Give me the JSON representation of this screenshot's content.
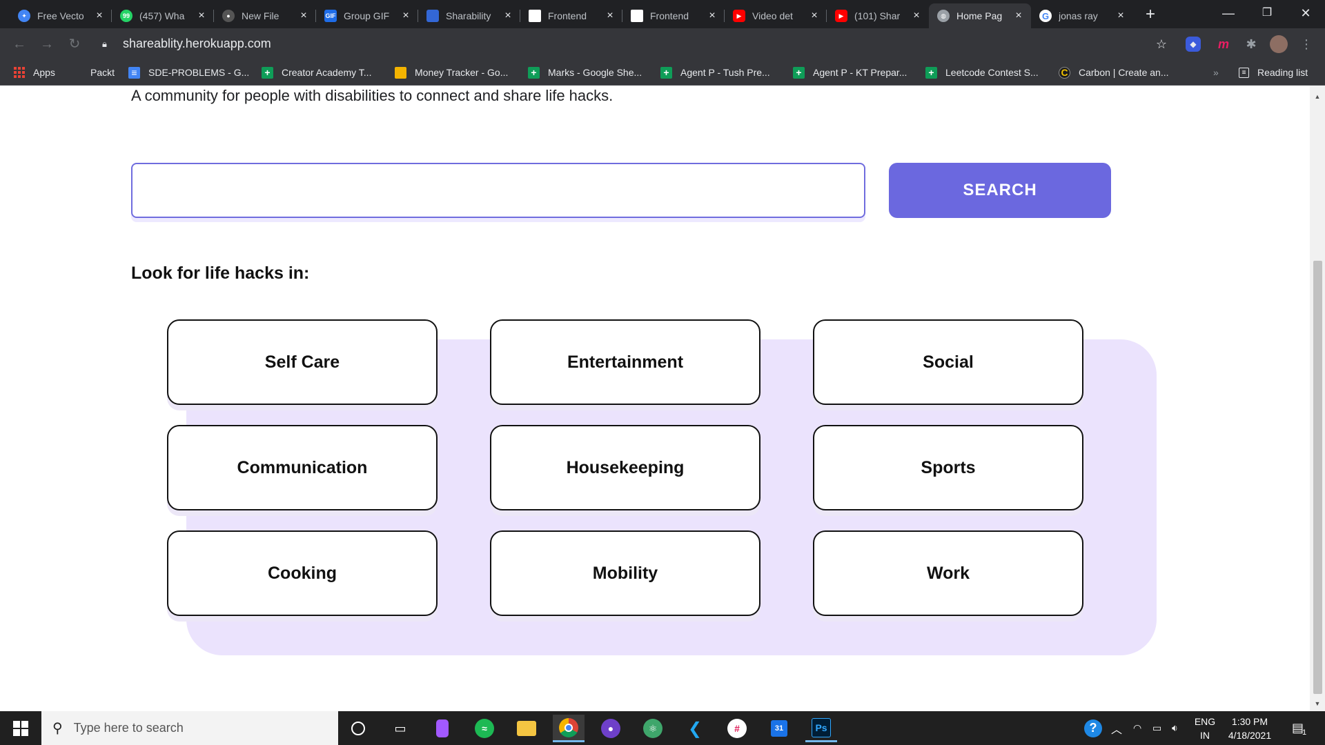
{
  "browser": {
    "tabs": [
      {
        "label": "Free Vecto",
        "icon": "shield-icon",
        "color": "#4285f4"
      },
      {
        "label": "(457) Wha",
        "icon": "whatsapp-icon",
        "color": "#25d366"
      },
      {
        "label": "New File",
        "icon": "github-icon",
        "color": "#555555"
      },
      {
        "label": "Group GIF",
        "icon": "gif-icon",
        "color": "#1e6ce8"
      },
      {
        "label": "Sharability",
        "icon": "doc-icon",
        "color": "#3367d6"
      },
      {
        "label": "Frontend",
        "icon": "page-icon",
        "color": "#ffffff"
      },
      {
        "label": "Frontend",
        "icon": "page-icon",
        "color": "#ffffff"
      },
      {
        "label": "Video det",
        "icon": "youtube-icon",
        "color": "#ff0000"
      },
      {
        "label": "(101) Shar",
        "icon": "youtube-icon",
        "color": "#ff0000"
      },
      {
        "label": "Home Pag",
        "icon": "globe-icon",
        "color": "#9aa0a6",
        "active": true
      },
      {
        "label": "jonas ray",
        "icon": "google-icon",
        "color": "#ffffff"
      }
    ],
    "new_tab": "+",
    "window_controls": {
      "minimize": "—",
      "restore": "❐",
      "close": "✕"
    },
    "nav": {
      "back": "←",
      "forward": "→",
      "reload": "↻"
    },
    "url": "shareablity.herokuapp.com",
    "bookmarks": [
      {
        "label": "Apps",
        "icon": "apps-grid-icon"
      },
      {
        "label": "Packt",
        "icon": ""
      },
      {
        "label": "SDE-PROBLEMS - G...",
        "icon": "docs-icon"
      },
      {
        "label": "Creator Academy T...",
        "icon": "sheets-icon"
      },
      {
        "label": "Money Tracker - Go...",
        "icon": "slides-icon"
      },
      {
        "label": "Marks - Google She...",
        "icon": "sheets-icon"
      },
      {
        "label": "Agent P - Tush Pre...",
        "icon": "sheets-icon"
      },
      {
        "label": "Agent P - KT Prepar...",
        "icon": "sheets-icon"
      },
      {
        "label": "Leetcode Contest S...",
        "icon": "sheets-icon"
      },
      {
        "label": "Carbon | Create an...",
        "icon": "carbon-icon"
      }
    ],
    "bookmarks_more": "»",
    "reading_list": "Reading list"
  },
  "page": {
    "tagline": "A community for people with disabilities to connect and share life hacks.",
    "search": {
      "value": "",
      "placeholder": "",
      "button_label": "SEARCH"
    },
    "categories_heading": "Look for life hacks in:",
    "categories": [
      "Self Care",
      "Entertainment",
      "Social",
      "Communication",
      "Housekeeping",
      "Sports",
      "Cooking",
      "Mobility",
      "Work"
    ],
    "colors": {
      "accent": "#6b68df",
      "panel": "#ebe3fd"
    }
  },
  "taskbar": {
    "search_placeholder": "Type here to search",
    "language": "ENG",
    "region": "IN",
    "time": "1:30 PM",
    "date": "4/18/2021",
    "notification_count": "1"
  }
}
